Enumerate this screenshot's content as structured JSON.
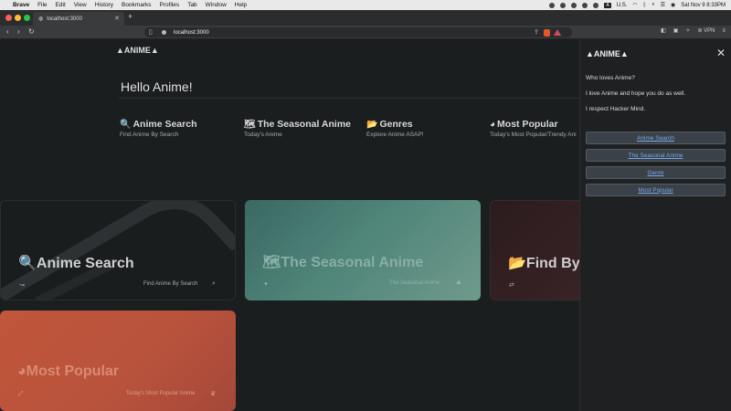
{
  "menubar": {
    "apple": "",
    "items": [
      "Brave",
      "File",
      "Edit",
      "View",
      "History",
      "Bookmarks",
      "Profiles",
      "Tab",
      "Window",
      "Help"
    ],
    "input_source": "U.S.",
    "clock": "Sat Nov 9  8:33PM"
  },
  "browser": {
    "tab_title": "localhost:3000",
    "tab_close": "✕",
    "new_tab": "+",
    "url": "localhost:3000",
    "vpn": "VPN"
  },
  "page": {
    "logo": "ANIME",
    "hello": "Hello Anime!",
    "sections": [
      {
        "icon": "🔍",
        "title": "Anime Search",
        "subtitle": "Find Anime By Search"
      },
      {
        "icon": "🗺",
        "title": "The Seasonal Anime",
        "subtitle": "Today's Anime"
      },
      {
        "icon": "📂",
        "title": "Genres",
        "subtitle": "Explore Anime ASAP!"
      },
      {
        "icon": "◕",
        "title": "Most Popular",
        "subtitle": "Today's Most Popular/Trendy Ani"
      }
    ],
    "cards": [
      {
        "title": "Anime Search",
        "sub": "Find Anime By Search"
      },
      {
        "title": "The Seasonal Anime",
        "sub": "The Seasonal Anime"
      },
      {
        "title": "Find By",
        "sub": ""
      },
      {
        "title": "Most Popular",
        "sub": "Today's Most Popular Anime"
      }
    ]
  },
  "sidebar": {
    "logo": "ANIME",
    "close": "✕",
    "lines": [
      "Who loves Anime?",
      "I love Anime and hope you do as well.",
      "I respect Hacker Mind."
    ],
    "buttons": [
      "Anime Search",
      "The Seasonal Anime",
      "Genre",
      "Most Popular"
    ]
  },
  "colors": {
    "menubar": "#e9e9e9",
    "page_bg": "#1b1e1f",
    "card_seasonal": "#4e8478",
    "card_popular": "#c0563a",
    "link": "#79a8e8"
  }
}
